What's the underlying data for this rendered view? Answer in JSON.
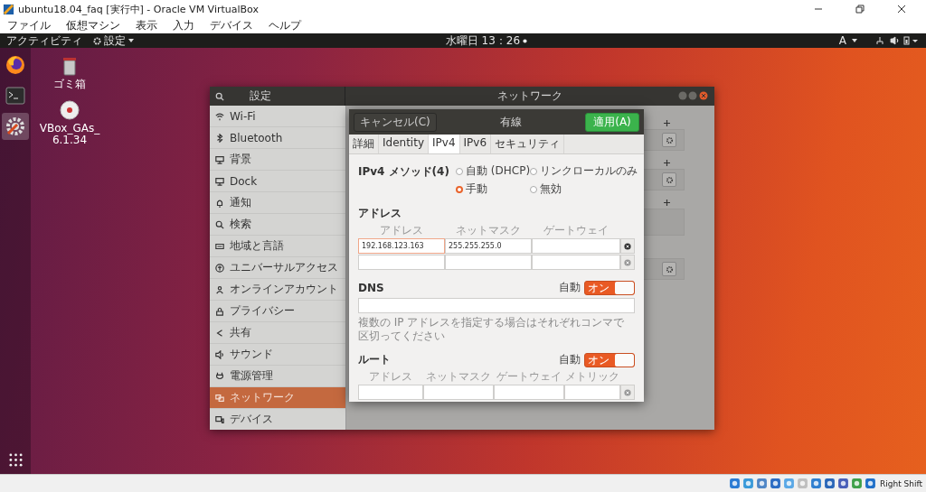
{
  "vbox_window": {
    "title": "ubuntu18.04_faq [実行中] - Oracle VM VirtualBox",
    "menu": [
      "ファイル",
      "仮想マシン",
      "表示",
      "入力",
      "デバイス",
      "ヘルプ"
    ]
  },
  "top_bar": {
    "activities": "アクティビティ",
    "app_menu": "設定",
    "clock": "水曜日 13：26",
    "input_method": "A"
  },
  "dock": [
    {
      "kind": "browser",
      "selected": false
    },
    {
      "kind": "terminal",
      "selected": false
    },
    {
      "kind": "settings",
      "selected": true
    }
  ],
  "desktop_icons": [
    {
      "kind": "trash",
      "lines": [
        "ゴミ箱"
      ]
    },
    {
      "kind": "disc",
      "lines": [
        "VBox_GAs_",
        "6.1.34"
      ]
    }
  ],
  "settings_window": {
    "sidebar_title": "設定",
    "title": "ネットワーク",
    "sidebar": [
      {
        "kind": "wifi",
        "label": "Wi-Fi",
        "selected": false
      },
      {
        "kind": "bluetooth",
        "label": "Bluetooth",
        "selected": false
      },
      {
        "kind": "monitor",
        "label": "背景",
        "selected": false
      },
      {
        "kind": "monitor",
        "label": "Dock",
        "selected": false
      },
      {
        "kind": "bell",
        "label": "通知",
        "selected": false
      },
      {
        "kind": "search",
        "label": "検索",
        "selected": false
      },
      {
        "kind": "keyboard",
        "label": "地域と言語",
        "selected": false
      },
      {
        "kind": "accessibility",
        "label": "ユニバーサルアクセス",
        "selected": false
      },
      {
        "kind": "person",
        "label": "オンラインアカウント",
        "selected": false
      },
      {
        "kind": "lock",
        "label": "プライバシー",
        "selected": false
      },
      {
        "kind": "share",
        "label": "共有",
        "selected": false
      },
      {
        "kind": "speaker",
        "label": "サウンド",
        "selected": false
      },
      {
        "kind": "plug",
        "label": "電源管理",
        "selected": false
      },
      {
        "kind": "network",
        "label": "ネットワーク",
        "selected": true
      },
      {
        "kind": "devices",
        "label": "デバイス",
        "selected": false
      }
    ],
    "sections": [
      {
        "add": true,
        "kind": "settings"
      },
      {
        "add": true,
        "kind": "settings"
      },
      {
        "add": true,
        "kind": "empty"
      },
      {
        "add": false,
        "kind": "settings"
      }
    ]
  },
  "dialog": {
    "cancel": "キャンセル(C)",
    "title": "有線",
    "apply": "適用(A)",
    "tabs": [
      {
        "label": "詳細",
        "selected": false
      },
      {
        "label": "Identity",
        "selected": false
      },
      {
        "label": "IPv4",
        "selected": true
      },
      {
        "label": "IPv6",
        "selected": false
      },
      {
        "label": "セキュリティ",
        "selected": false
      }
    ],
    "method_label": "IPv4 メソッド(4)",
    "methods": [
      {
        "label": "自動 (DHCP)",
        "selected": false
      },
      {
        "label": "リンクローカルのみ",
        "selected": false
      },
      {
        "label": "手動",
        "selected": true
      },
      {
        "label": "無効",
        "selected": false
      }
    ],
    "address": {
      "label": "アドレス",
      "columns": [
        "アドレス",
        "ネットマスク",
        "ゲートウェイ"
      ],
      "rows": [
        {
          "address": "192.168.123.163",
          "netmask": "255.255.255.0",
          "focused": true
        },
        {
          "focused": false
        }
      ]
    },
    "dns": {
      "label": "DNS",
      "auto_label": "自動",
      "switch": {
        "on": true,
        "text": "オン"
      },
      "hint": "複数の IP アドレスを指定する場合はそれぞれコンマで区切ってください"
    },
    "routes": {
      "label": "ルート",
      "auto_label": "自動",
      "switch": {
        "on": true,
        "text": "オン"
      },
      "columns": [
        "アドレス",
        "ネットマスク",
        "ゲートウェイ",
        "メトリック"
      ]
    }
  },
  "status_bar": {
    "host_key": "Right Shift"
  }
}
